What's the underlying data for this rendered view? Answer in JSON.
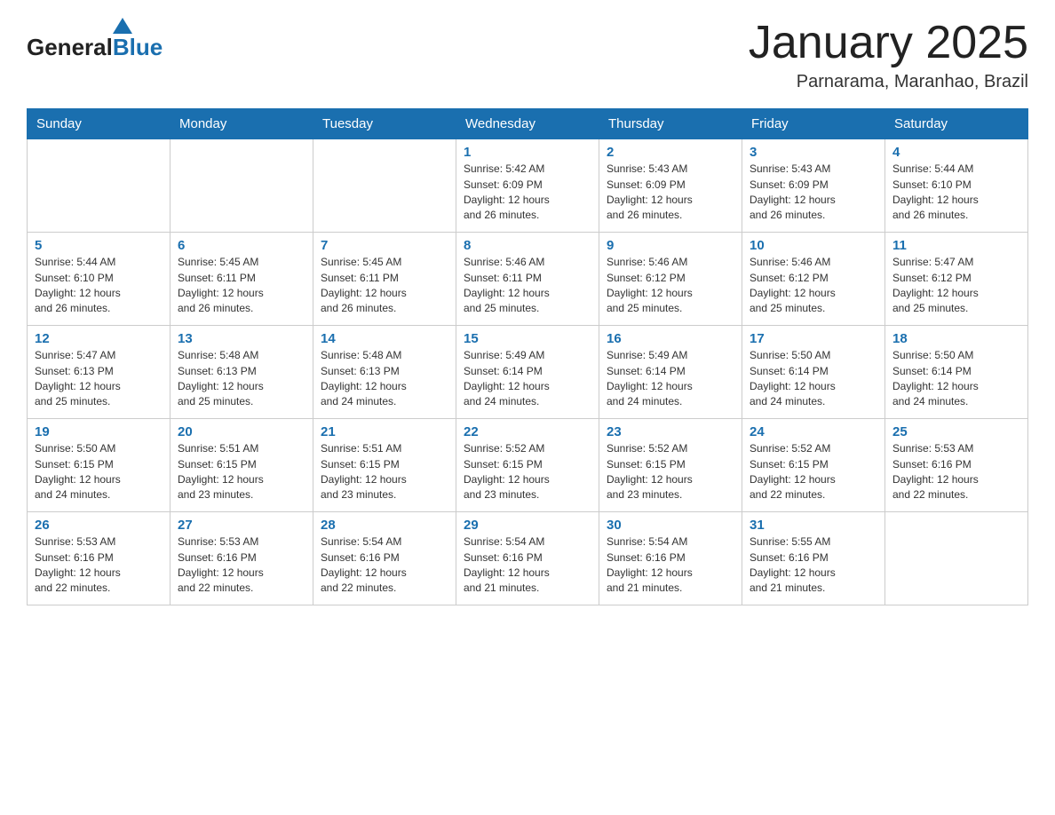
{
  "logo": {
    "general": "General",
    "blue": "Blue"
  },
  "title": {
    "month_year": "January 2025",
    "location": "Parnarama, Maranhao, Brazil"
  },
  "headers": [
    "Sunday",
    "Monday",
    "Tuesday",
    "Wednesday",
    "Thursday",
    "Friday",
    "Saturday"
  ],
  "weeks": [
    [
      {
        "day": "",
        "info": ""
      },
      {
        "day": "",
        "info": ""
      },
      {
        "day": "",
        "info": ""
      },
      {
        "day": "1",
        "info": "Sunrise: 5:42 AM\nSunset: 6:09 PM\nDaylight: 12 hours\nand 26 minutes."
      },
      {
        "day": "2",
        "info": "Sunrise: 5:43 AM\nSunset: 6:09 PM\nDaylight: 12 hours\nand 26 minutes."
      },
      {
        "day": "3",
        "info": "Sunrise: 5:43 AM\nSunset: 6:09 PM\nDaylight: 12 hours\nand 26 minutes."
      },
      {
        "day": "4",
        "info": "Sunrise: 5:44 AM\nSunset: 6:10 PM\nDaylight: 12 hours\nand 26 minutes."
      }
    ],
    [
      {
        "day": "5",
        "info": "Sunrise: 5:44 AM\nSunset: 6:10 PM\nDaylight: 12 hours\nand 26 minutes."
      },
      {
        "day": "6",
        "info": "Sunrise: 5:45 AM\nSunset: 6:11 PM\nDaylight: 12 hours\nand 26 minutes."
      },
      {
        "day": "7",
        "info": "Sunrise: 5:45 AM\nSunset: 6:11 PM\nDaylight: 12 hours\nand 26 minutes."
      },
      {
        "day": "8",
        "info": "Sunrise: 5:46 AM\nSunset: 6:11 PM\nDaylight: 12 hours\nand 25 minutes."
      },
      {
        "day": "9",
        "info": "Sunrise: 5:46 AM\nSunset: 6:12 PM\nDaylight: 12 hours\nand 25 minutes."
      },
      {
        "day": "10",
        "info": "Sunrise: 5:46 AM\nSunset: 6:12 PM\nDaylight: 12 hours\nand 25 minutes."
      },
      {
        "day": "11",
        "info": "Sunrise: 5:47 AM\nSunset: 6:12 PM\nDaylight: 12 hours\nand 25 minutes."
      }
    ],
    [
      {
        "day": "12",
        "info": "Sunrise: 5:47 AM\nSunset: 6:13 PM\nDaylight: 12 hours\nand 25 minutes."
      },
      {
        "day": "13",
        "info": "Sunrise: 5:48 AM\nSunset: 6:13 PM\nDaylight: 12 hours\nand 25 minutes."
      },
      {
        "day": "14",
        "info": "Sunrise: 5:48 AM\nSunset: 6:13 PM\nDaylight: 12 hours\nand 24 minutes."
      },
      {
        "day": "15",
        "info": "Sunrise: 5:49 AM\nSunset: 6:14 PM\nDaylight: 12 hours\nand 24 minutes."
      },
      {
        "day": "16",
        "info": "Sunrise: 5:49 AM\nSunset: 6:14 PM\nDaylight: 12 hours\nand 24 minutes."
      },
      {
        "day": "17",
        "info": "Sunrise: 5:50 AM\nSunset: 6:14 PM\nDaylight: 12 hours\nand 24 minutes."
      },
      {
        "day": "18",
        "info": "Sunrise: 5:50 AM\nSunset: 6:14 PM\nDaylight: 12 hours\nand 24 minutes."
      }
    ],
    [
      {
        "day": "19",
        "info": "Sunrise: 5:50 AM\nSunset: 6:15 PM\nDaylight: 12 hours\nand 24 minutes."
      },
      {
        "day": "20",
        "info": "Sunrise: 5:51 AM\nSunset: 6:15 PM\nDaylight: 12 hours\nand 23 minutes."
      },
      {
        "day": "21",
        "info": "Sunrise: 5:51 AM\nSunset: 6:15 PM\nDaylight: 12 hours\nand 23 minutes."
      },
      {
        "day": "22",
        "info": "Sunrise: 5:52 AM\nSunset: 6:15 PM\nDaylight: 12 hours\nand 23 minutes."
      },
      {
        "day": "23",
        "info": "Sunrise: 5:52 AM\nSunset: 6:15 PM\nDaylight: 12 hours\nand 23 minutes."
      },
      {
        "day": "24",
        "info": "Sunrise: 5:52 AM\nSunset: 6:15 PM\nDaylight: 12 hours\nand 22 minutes."
      },
      {
        "day": "25",
        "info": "Sunrise: 5:53 AM\nSunset: 6:16 PM\nDaylight: 12 hours\nand 22 minutes."
      }
    ],
    [
      {
        "day": "26",
        "info": "Sunrise: 5:53 AM\nSunset: 6:16 PM\nDaylight: 12 hours\nand 22 minutes."
      },
      {
        "day": "27",
        "info": "Sunrise: 5:53 AM\nSunset: 6:16 PM\nDaylight: 12 hours\nand 22 minutes."
      },
      {
        "day": "28",
        "info": "Sunrise: 5:54 AM\nSunset: 6:16 PM\nDaylight: 12 hours\nand 22 minutes."
      },
      {
        "day": "29",
        "info": "Sunrise: 5:54 AM\nSunset: 6:16 PM\nDaylight: 12 hours\nand 21 minutes."
      },
      {
        "day": "30",
        "info": "Sunrise: 5:54 AM\nSunset: 6:16 PM\nDaylight: 12 hours\nand 21 minutes."
      },
      {
        "day": "31",
        "info": "Sunrise: 5:55 AM\nSunset: 6:16 PM\nDaylight: 12 hours\nand 21 minutes."
      },
      {
        "day": "",
        "info": ""
      }
    ]
  ]
}
